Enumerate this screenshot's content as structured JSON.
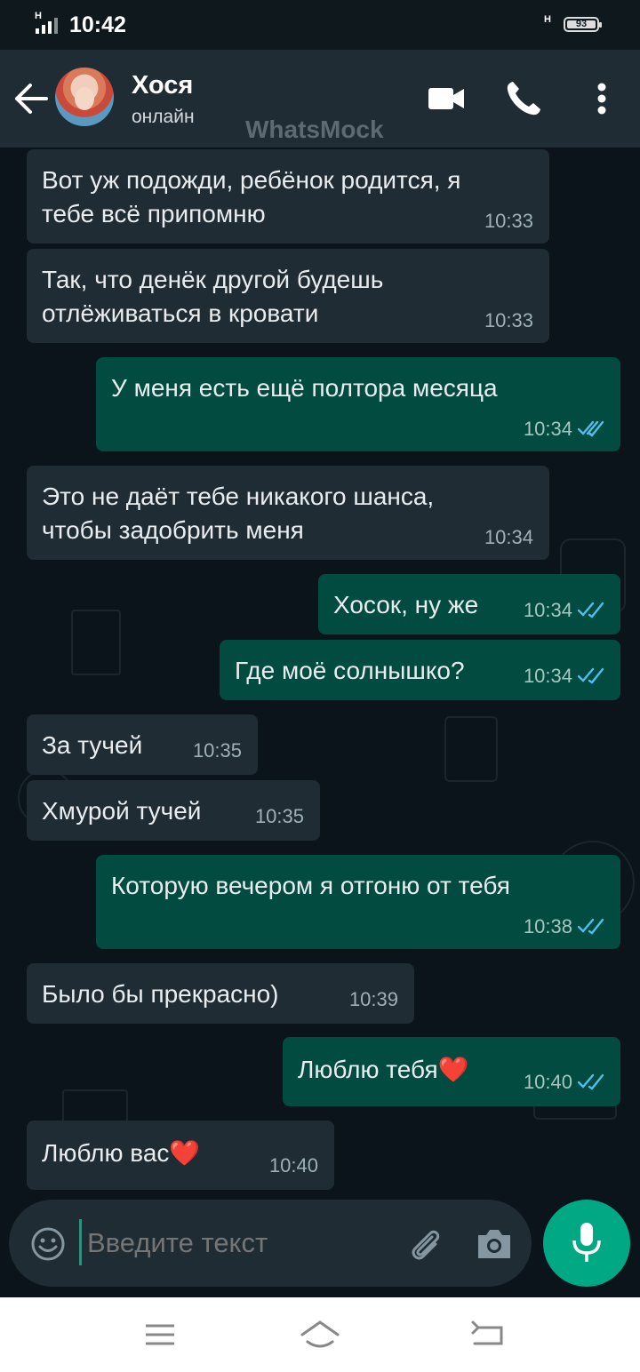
{
  "status_bar": {
    "time": "10:42",
    "network": "H",
    "network2": "H",
    "battery": "93"
  },
  "header": {
    "contact_name": "Хося",
    "contact_status": "онлайн",
    "watermark": "WhatsMock",
    "icons": [
      "back-arrow-icon",
      "avatar",
      "video-call-icon",
      "phone-icon",
      "more-vert-icon"
    ]
  },
  "messages": [
    {
      "dir": "in",
      "text": "Вот уж подожди, ребёнок родится, я\nтебе всё припомню",
      "time": "10:33"
    },
    {
      "dir": "in",
      "text": "Так, что денёк другой будешь\nотлёживаться в кровати",
      "time": "10:33"
    },
    {
      "dir": "out",
      "text": "У меня есть ещё полтора месяца",
      "time": "10:34",
      "status": "read"
    },
    {
      "dir": "in",
      "text": "Это не даёт тебе никакого шанса,\nчтобы задобрить меня",
      "time": "10:34"
    },
    {
      "dir": "out",
      "text": "Хосок, ну же",
      "time": "10:34",
      "status": "read"
    },
    {
      "dir": "out",
      "text": "Где моё солнышко?",
      "time": "10:34",
      "status": "read"
    },
    {
      "dir": "in",
      "text": "За тучей",
      "time": "10:35"
    },
    {
      "dir": "in",
      "text": "Хмурой тучей",
      "time": "10:35"
    },
    {
      "dir": "out",
      "text": "Которую вечером я отгоню от тебя",
      "time": "10:38",
      "status": "read"
    },
    {
      "dir": "in",
      "text": "Было бы прекрасно)",
      "time": "10:39"
    },
    {
      "dir": "out",
      "text": "Люблю тебя",
      "emoji": "❤️",
      "time": "10:40",
      "status": "read"
    },
    {
      "dir": "in",
      "text": "Люблю вас",
      "emoji": "❤️",
      "time": "10:40"
    }
  ],
  "composer": {
    "placeholder": "Введите текст"
  },
  "colors": {
    "accent": "#00a884",
    "incoming": "#1f2c33",
    "outgoing": "#014b40",
    "read_ticks": "#53bdeb"
  }
}
